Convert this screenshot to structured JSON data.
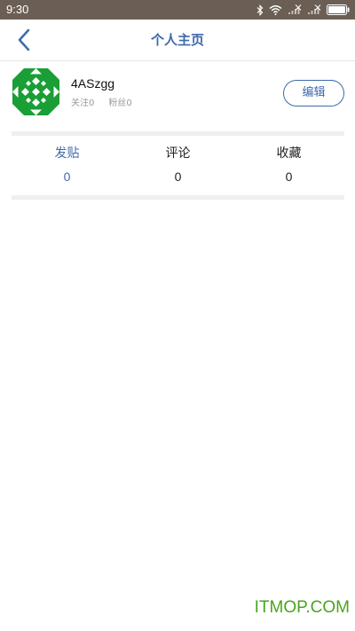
{
  "status_bar": {
    "time": "9:30",
    "icons": [
      "bluetooth-icon",
      "wifi-icon",
      "signal-icon",
      "signal-icon",
      "battery-icon"
    ]
  },
  "header": {
    "title": "个人主页",
    "back_icon": "chevron-left-icon"
  },
  "profile": {
    "username": "4ASzgg",
    "following": "关注0",
    "followers": "粉丝0",
    "edit_label": "编辑",
    "avatar_color": "#1a9e36"
  },
  "stats": [
    {
      "label": "发贴",
      "count": "0",
      "active": true
    },
    {
      "label": "评论",
      "count": "0",
      "active": false
    },
    {
      "label": "收藏",
      "count": "0",
      "active": false
    }
  ],
  "watermark": "ITMOP.COM",
  "colors": {
    "accent": "#3e6aaa",
    "status_bar": "#6b5f55",
    "watermark": "#4aa41e"
  }
}
